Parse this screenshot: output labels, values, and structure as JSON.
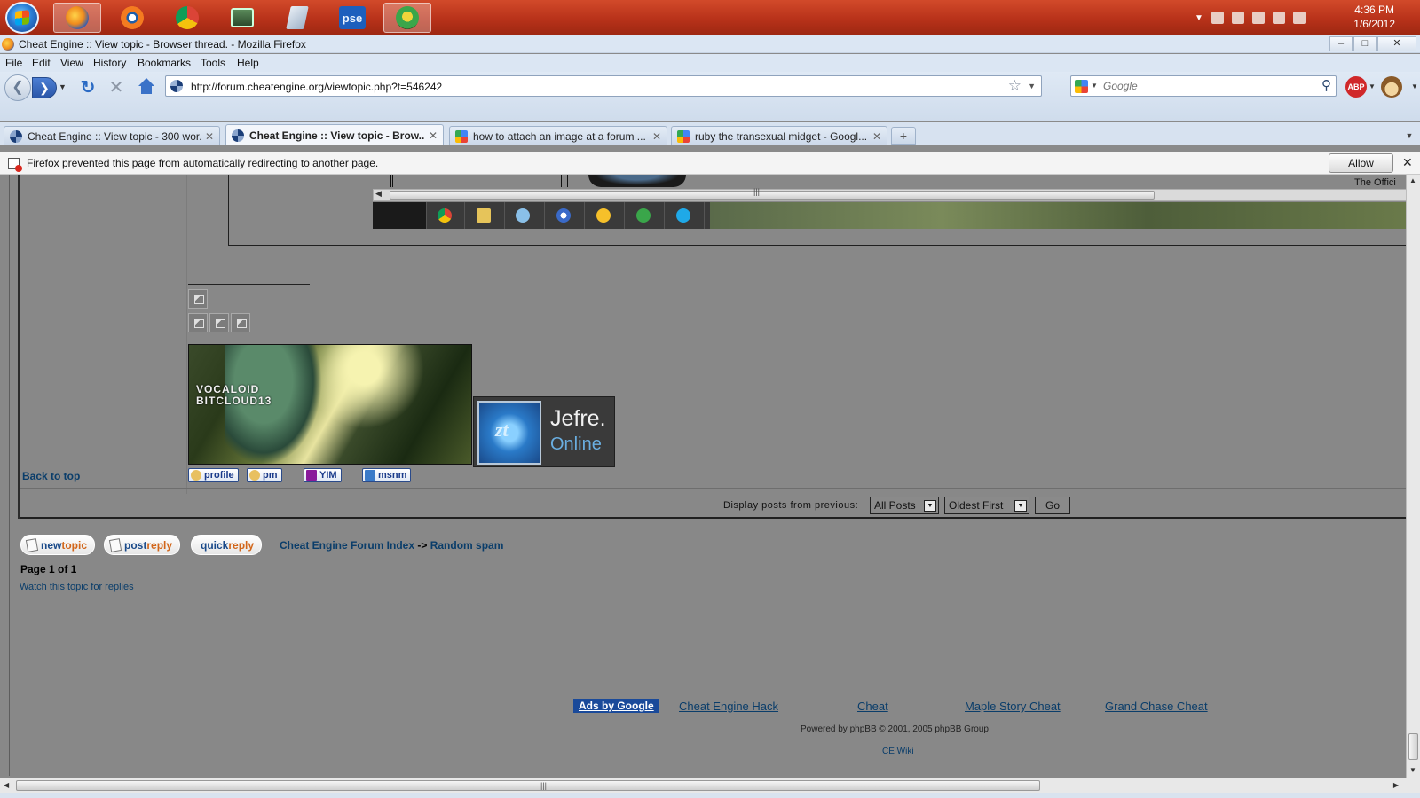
{
  "taskbar": {
    "apps": [
      "firefox",
      "blender",
      "chrome",
      "monitor",
      "notepad",
      "photoshop-elements",
      "game"
    ],
    "pse_label": "pse",
    "clock": {
      "time": "4:36 PM",
      "date": "1/6/2012"
    }
  },
  "window": {
    "title": "Cheat Engine :: View topic - Browser thread. - Mozilla Firefox",
    "minimize": "–",
    "restore": "□",
    "close": "✕"
  },
  "menu": [
    "File",
    "Edit",
    "View",
    "History",
    "Bookmarks",
    "Tools",
    "Help"
  ],
  "nav": {
    "url": "http://forum.cheatengine.org/viewtopic.php?t=546242",
    "search_placeholder": "Google",
    "abp_label": "ABP"
  },
  "tabs": [
    {
      "label": "Cheat Engine :: View topic - 300 wor...",
      "favicon": "cheatengine",
      "selected": false
    },
    {
      "label": "Cheat Engine :: View topic - Brow...",
      "favicon": "cheatengine",
      "selected": true
    },
    {
      "label": "how to attach an image at a forum ...",
      "favicon": "google",
      "selected": false
    },
    {
      "label": "ruby the transexual midget - Googl...",
      "favicon": "google",
      "selected": false
    }
  ],
  "notification": {
    "text": "Firefox prevented this page from automatically redirecting to another page.",
    "allow_label": "Allow"
  },
  "post": {
    "embed_corner_text": "The Offici",
    "signature_banner_text": "VOCALOID\nBITCLOUD13",
    "status_name": "Jefre.",
    "status_state": "Online",
    "back_to_top": "Back to top",
    "profile_buttons": [
      "profile",
      "pm",
      "YIM",
      "msnm"
    ]
  },
  "sort": {
    "label": "Display posts from previous:",
    "period": "All Posts",
    "order": "Oldest First",
    "go_label": "Go"
  },
  "actions": {
    "new_topic": {
      "a": "new",
      "b": "topic"
    },
    "post_reply": {
      "a": "post",
      "b": "reply"
    },
    "quick_reply": {
      "a": "quick",
      "b": "reply"
    }
  },
  "breadcrumb": {
    "index": "Cheat Engine Forum Index",
    "sep": "->",
    "forum": "Random spam"
  },
  "pagination": {
    "text": "Page 1 of 1"
  },
  "watch_link": "Watch this topic for replies",
  "ads": {
    "label": "Ads by Google",
    "links": [
      "Cheat Engine Hack",
      "Cheat",
      "Maple Story Cheat",
      "Grand Chase Cheat"
    ]
  },
  "footer": {
    "powered_by": "Powered by phpBB © 2001, 2005 phpBB Group",
    "wiki": "CE Wiki"
  }
}
